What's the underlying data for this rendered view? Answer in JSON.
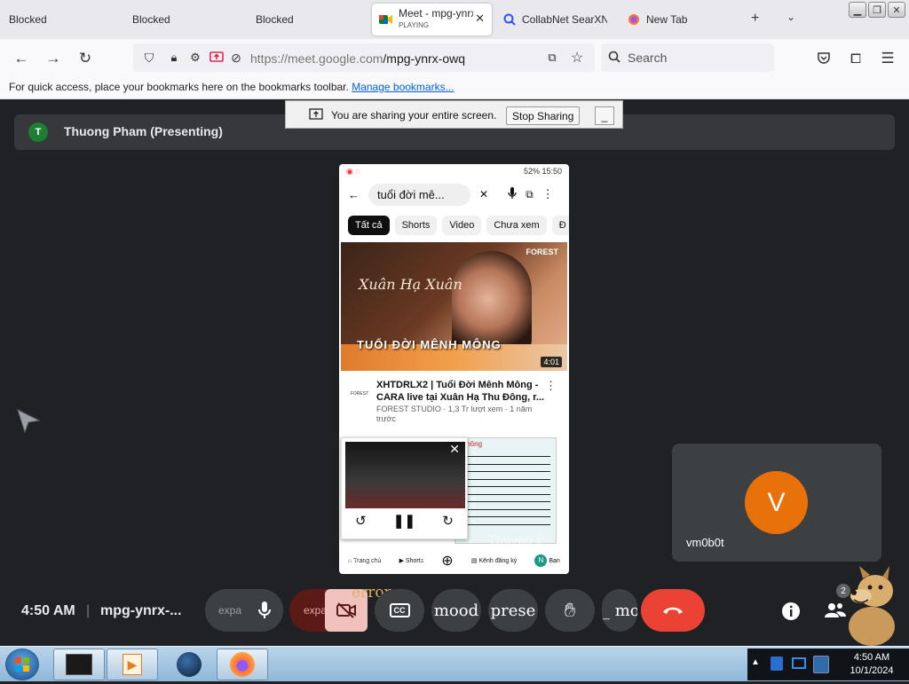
{
  "browser": {
    "tabs": [
      {
        "title": "Blocked"
      },
      {
        "title": "Blocked"
      },
      {
        "title": "Blocked"
      },
      {
        "title": "Meet - mpg-ynrx",
        "subtitle": "PLAYING",
        "active": true
      },
      {
        "title": "CollabNet SearXN"
      },
      {
        "title": "New Tab"
      }
    ],
    "url_host": "https://meet.google.com",
    "url_path": "/mpg-ynrx-owq",
    "search_placeholder": "Search",
    "bookmarks_text": "For quick access, place your bookmarks here on the bookmarks toolbar.",
    "bookmarks_link": "Manage bookmarks..."
  },
  "share_banner": {
    "message": "You are sharing your entire screen.",
    "stop_label": "Stop Sharing",
    "minimize_label": "_"
  },
  "presenter": {
    "initial": "T",
    "name": "Thuong Pham (Presenting)"
  },
  "phone": {
    "status_right": "52% 15:50",
    "search_query": "tuổi đời mê...",
    "chips": [
      "Tất cả",
      "Shorts",
      "Video",
      "Chưa xem",
      "Đ"
    ],
    "thumb_brand": "FOREST",
    "thumb_script": "Xuân Hạ Xuân",
    "thumb_title": "TUỔI ĐỜI MÊNH MÔNG",
    "duration": "4:01",
    "channel_logo": "FOREST",
    "video_title": "XHTDRLX2 | Tuổi Đời Mênh Mông - CARA live tại Xuân Hạ Thu Đông, r...",
    "video_meta": "FOREST STUDIO · 1,3 Tr lượt xem · 1 năm trước",
    "sheet_title": "mông",
    "bottom_nav": [
      "Trang chủ",
      "Shorts",
      "",
      "Kênh đăng ký",
      "Bạn"
    ],
    "overlay_words": [
      "presen",
      "to",
      "Thuong P"
    ]
  },
  "participant": {
    "initial": "V",
    "name": "vm0b0t"
  },
  "controls": {
    "time": "4:50 AM",
    "separator": "|",
    "meeting_code": "mpg-ynrx-...",
    "expand_left": "expa",
    "expand_red": "expand less",
    "error_label": "error",
    "mood": "mood",
    "present": "prese",
    "more": "_ mor",
    "people_count": "2"
  },
  "taskbar": {
    "time": "4:50 AM",
    "date": "10/1/2024"
  }
}
